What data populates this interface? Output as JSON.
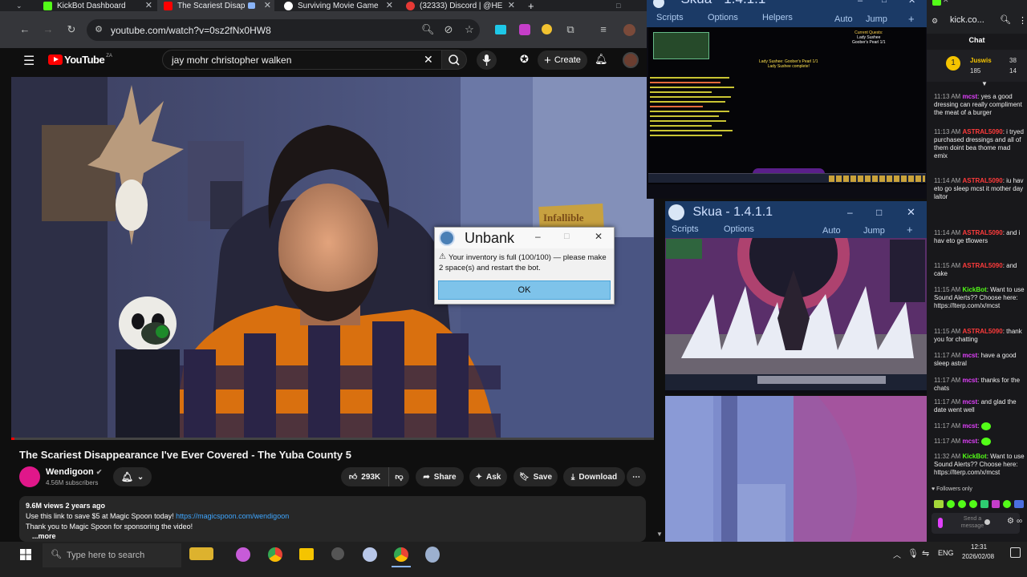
{
  "browser": {
    "tabs": [
      {
        "label": "KickBot Dashboard",
        "color": "#53fc18"
      },
      {
        "label": "The Scariest Disap",
        "color": "#ff0000"
      },
      {
        "label": "Surviving Movie Game",
        "color": "#ffffff"
      },
      {
        "label": "(32333) Discord | @HE",
        "color": "#e53935"
      }
    ],
    "url": "youtube.com/watch?v=0sz2fNx0HW8",
    "new_tab": "+"
  },
  "youtube": {
    "logo": "YouTube",
    "country": "ZA",
    "search_value": "jay mohr christopher walken",
    "create_label": "Create",
    "video_title": "The Scariest Disappearance I've Ever Covered - The Yuba County 5",
    "channel": "Wendigoon",
    "subscribers": "4.56M subscribers",
    "likes": "293K",
    "share": "Share",
    "ask": "Ask",
    "save": "Save",
    "download": "Download",
    "views": "9.6M views  2 years ago",
    "desc_line1": "Use this link to save $5 at Magic Spoon today!",
    "desc_link": "https://magicspoon.com/wendigoon",
    "desc_line2": "Thank you to Magic Spoon for sponsoring the video!",
    "more": "...more",
    "sign_text": "Infallible"
  },
  "skua_top": {
    "title": "Skua - 1.4.1.1",
    "menu": [
      "Scripts",
      "Options",
      "Helpers",
      "Auto",
      "Jump"
    ],
    "quest_title": "Current Quests:",
    "quest_sub": "Lady Sushee",
    "quest_sub2": "Goober's Pearl 1/1",
    "center_line1": "Lady Sushee: Goober's Pearl 1/1",
    "center_line2": "Lady Sushee complete!"
  },
  "skua_bottom": {
    "title": "Skua - 1.4.1.1",
    "menu": [
      "Scripts",
      "Options",
      "Auto",
      "Jump"
    ]
  },
  "dialog": {
    "title": "Unbank",
    "message": "Your inventory is full (100/100) — please make 2 space(s) and restart the bot.",
    "ok": "OK"
  },
  "kick": {
    "site": "kick.co...",
    "chat_label": "Chat",
    "user": "Juswis",
    "stat1": "38",
    "stat2": "185",
    "stat3": "14",
    "messages": [
      {
        "time": "11:13 AM",
        "user": "mcst",
        "color": "#e040fb",
        "text": "yes a good dressing can really compliment the meat of a burger"
      },
      {
        "time": "11:13 AM",
        "user": "ASTRAL5090",
        "color": "#ff3b3b",
        "text": "i tryed purchased dressings and all of them doint bea thome mad emix"
      },
      {
        "time": "11:14 AM",
        "user": "ASTRAL5090",
        "color": "#ff3b3b",
        "text": "iu hav eto go sleep mcst it mother day laltor"
      },
      {
        "time": "11:14 AM",
        "user": "ASTRAL5090",
        "color": "#ff3b3b",
        "text": "and i hav eto ge tflowers"
      },
      {
        "time": "11:15 AM",
        "user": "ASTRAL5090",
        "color": "#ff3b3b",
        "text": "and cake"
      },
      {
        "time": "11:15 AM",
        "user": "KickBot",
        "color": "#53fc18",
        "text": "Want to use Sound Alerts?? Choose here: https://lterp.com/x/mcst"
      },
      {
        "time": "11:15 AM",
        "user": "ASTRAL5090",
        "color": "#ff3b3b",
        "text": "thank you for chatting"
      },
      {
        "time": "11:17 AM",
        "user": "mcst",
        "color": "#e040fb",
        "text": "have a good sleep astral"
      },
      {
        "time": "11:17 AM",
        "user": "mcst",
        "color": "#e040fb",
        "text": "thanks for the chats"
      },
      {
        "time": "11:17 AM",
        "user": "mcst",
        "color": "#e040fb",
        "text": "and glad the date went well"
      },
      {
        "time": "11:17 AM",
        "user": "mcst",
        "color": "#e040fb",
        "text": ""
      },
      {
        "time": "11:17 AM",
        "user": "mcst",
        "color": "#e040fb",
        "text": ""
      },
      {
        "time": "11:32 AM",
        "user": "KickBot",
        "color": "#53fc18",
        "text": "Want to use Sound Alerts?? Choose here: https://lterp.com/x/mcst"
      }
    ],
    "followers_only": "Followers only",
    "send_placeholder": "Send a message"
  },
  "taskbar": {
    "search_placeholder": "Type here to search",
    "lang": "ENG",
    "time": "12:31",
    "date": "2026/02/08"
  }
}
